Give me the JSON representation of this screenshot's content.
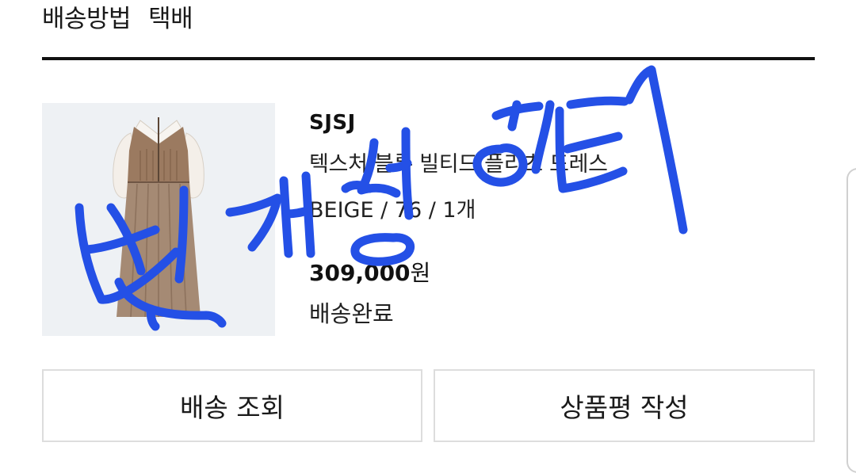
{
  "shipping": {
    "label": "배송방법",
    "value": "택배"
  },
  "order_item": {
    "brand": "SJSJ",
    "name": "텍스처 블록 빌티드 플리츠 드레스",
    "option": "BEIGE / 76 / 1개",
    "price_amount": "309,000",
    "price_unit": "원",
    "status": "배송완료"
  },
  "actions": {
    "track_label": "배송 조회",
    "review_label": "상품평 작성"
  },
  "overlay": {
    "ink_color": "#2450e6",
    "note": "handwritten marker scribble"
  },
  "colors": {
    "divider": "#111111",
    "button_border": "#dddddd",
    "thumb_bg": "#eef1f4"
  }
}
